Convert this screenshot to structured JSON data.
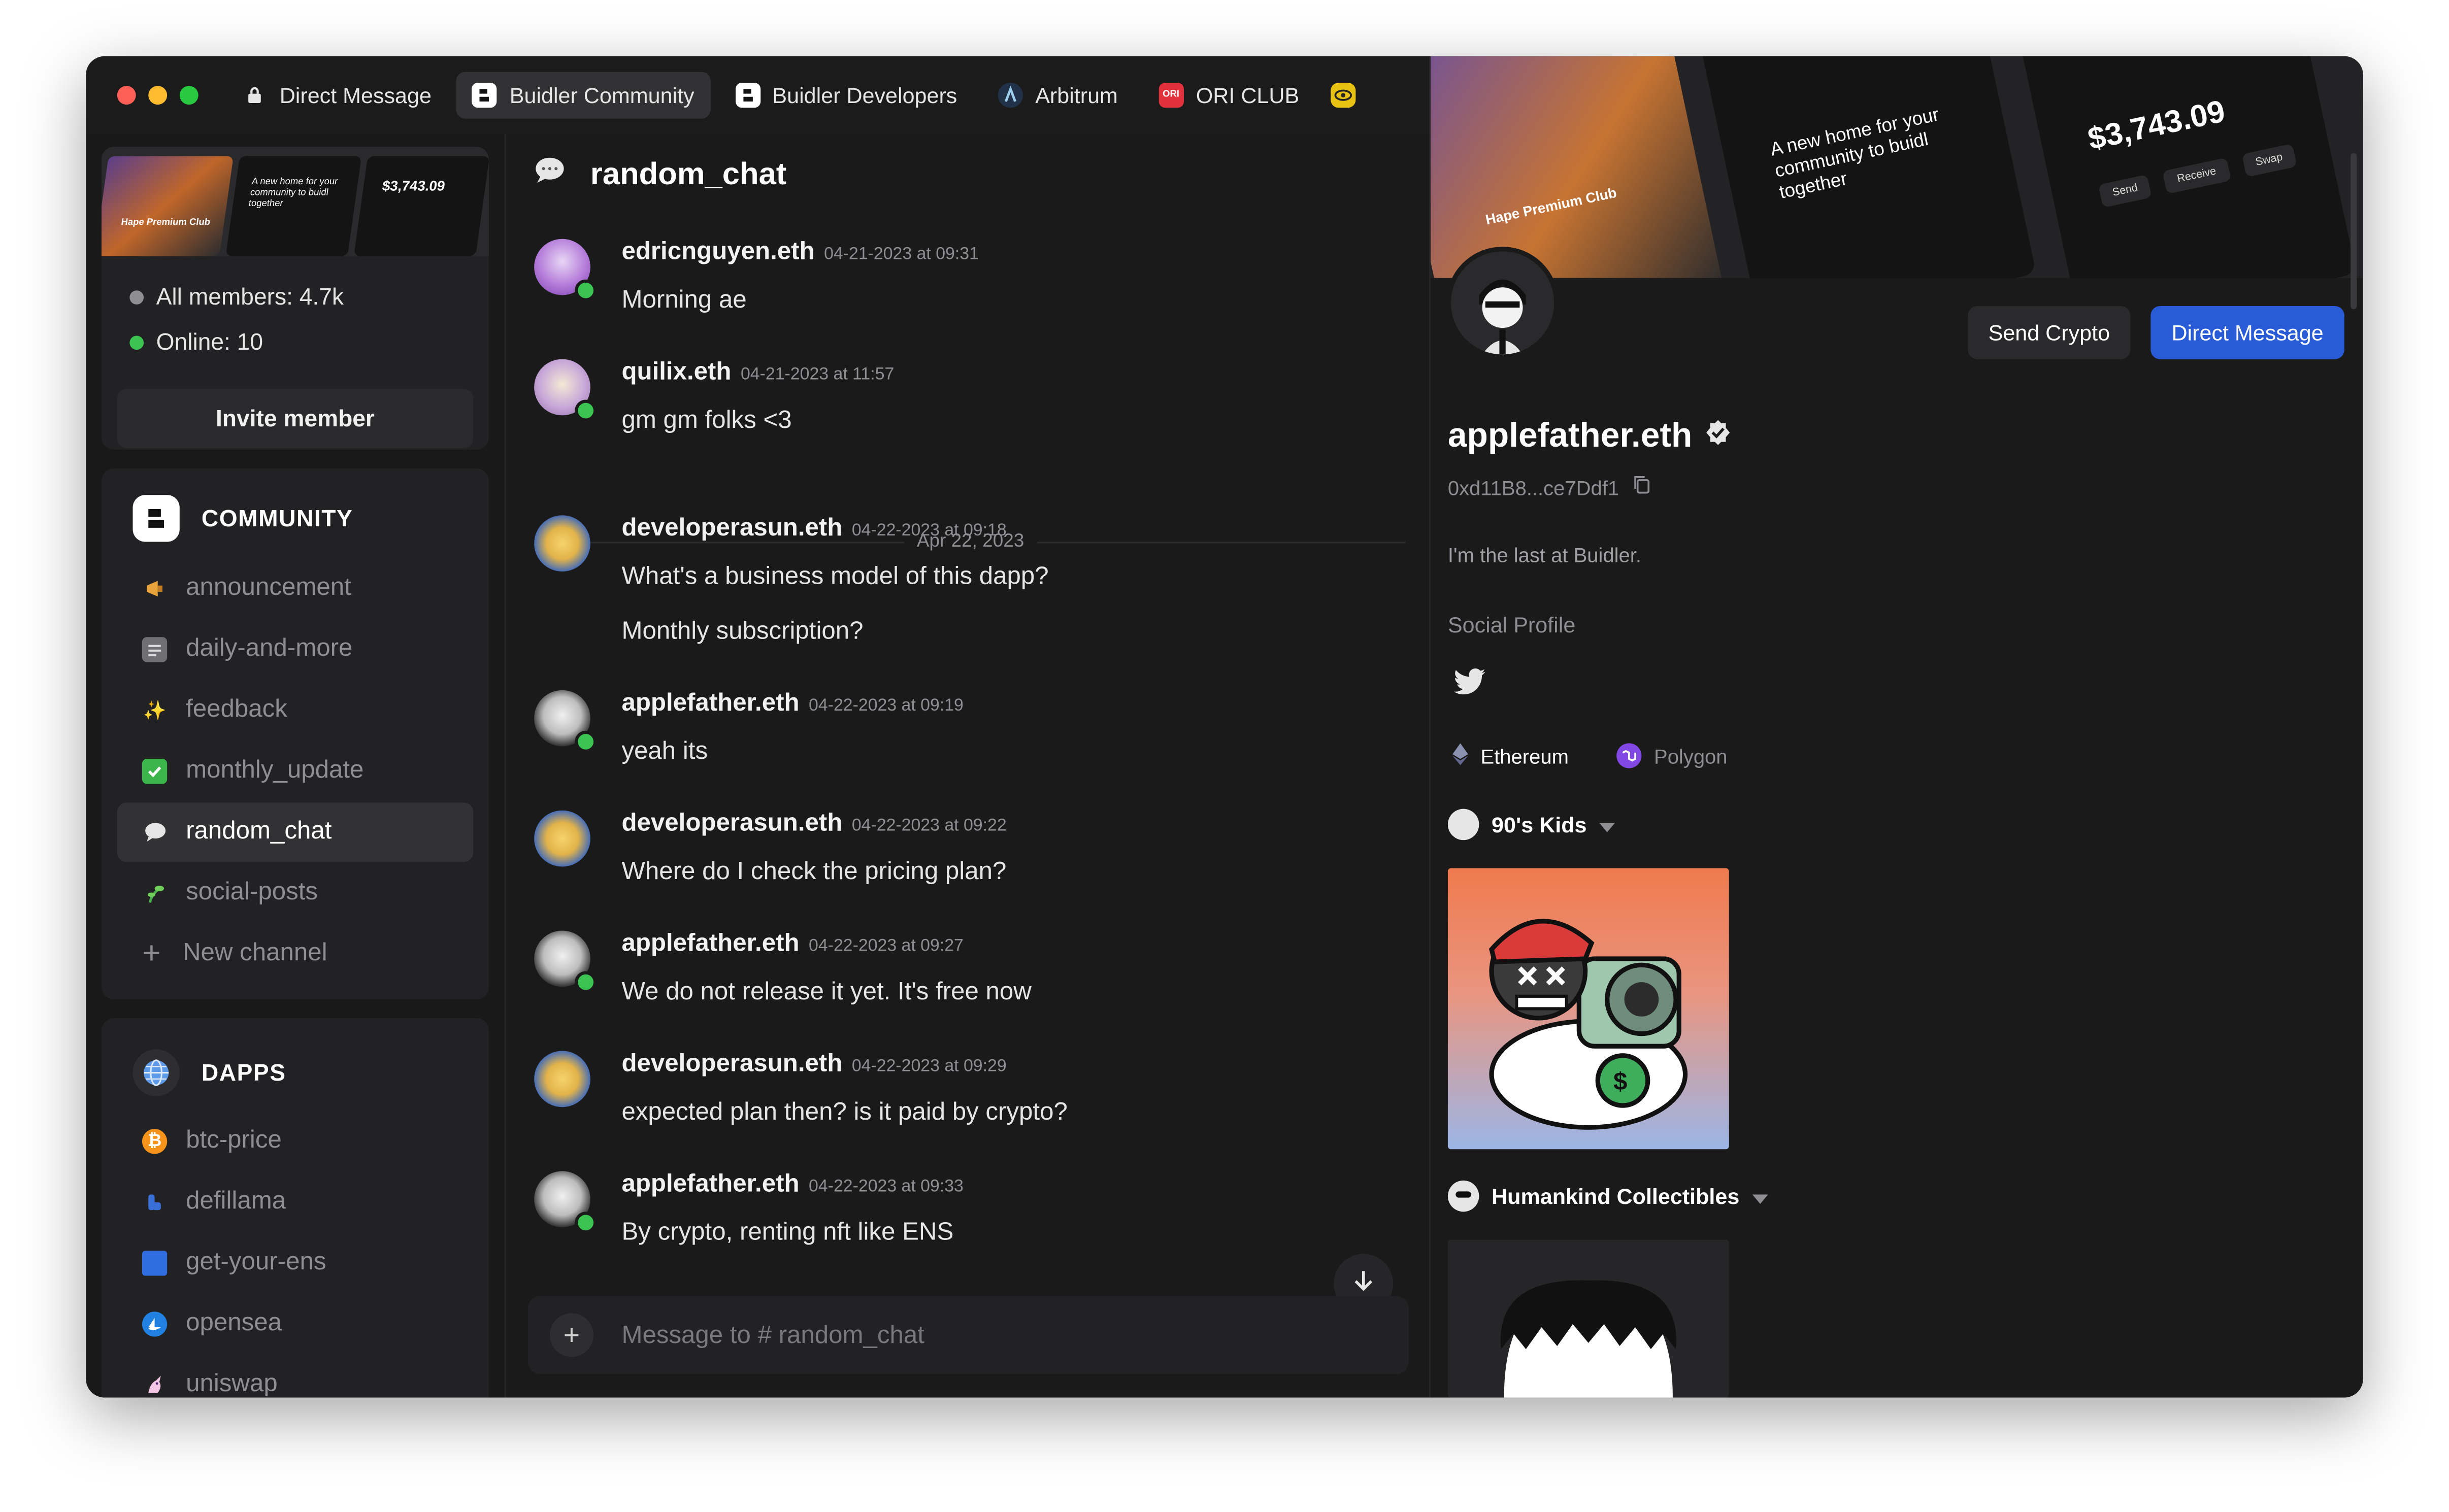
{
  "tabs": [
    {
      "label": "Direct Message",
      "icon": "lock-icon"
    },
    {
      "label": "Buidler Community",
      "icon": "buidler-logo-icon",
      "active": true
    },
    {
      "label": "Buidler Developers",
      "icon": "buidler-logo-icon"
    },
    {
      "label": "Arbitrum",
      "icon": "arbitrum-logo-icon"
    },
    {
      "label": "ORI CLUB",
      "icon": "ori-club-logo-icon"
    }
  ],
  "sidebar": {
    "banner_price": "$3,743.09",
    "banner_text": "A new home for your community to buidl together",
    "banner_club": "Hape Premium Club",
    "all_members": "All members: 4.7k",
    "online": "Online: 10",
    "invite_label": "Invite member",
    "community": {
      "title": "COMMUNITY",
      "channels": [
        {
          "name": "announcement",
          "icon": "megaphone-icon"
        },
        {
          "name": "daily-and-more",
          "icon": "newspaper-icon"
        },
        {
          "name": "feedback",
          "icon": "sparkles-icon"
        },
        {
          "name": "monthly_update",
          "icon": "check-box-icon"
        },
        {
          "name": "random_chat",
          "icon": "speech-bubble-icon",
          "active": true
        },
        {
          "name": "social-posts",
          "icon": "seedling-icon"
        }
      ],
      "new_channel": "New channel"
    },
    "dapps": {
      "title": "DAPPS",
      "items": [
        {
          "name": "btc-price",
          "icon": "bitcoin-icon"
        },
        {
          "name": "defillama",
          "icon": "llama-icon"
        },
        {
          "name": "get-your-ens",
          "icon": "blue-square-icon"
        },
        {
          "name": "opensea",
          "icon": "opensea-icon"
        },
        {
          "name": "uniswap",
          "icon": "unicorn-icon"
        }
      ]
    }
  },
  "chat": {
    "channel": "random_chat",
    "date_divider": "Apr 22, 2023",
    "messages": [
      {
        "user": "edricnguyen.eth",
        "time": "04-21-2023 at 09:31",
        "lines": [
          "Morning ae"
        ]
      },
      {
        "user": "quilix.eth",
        "time": "04-21-2023 at 11:57",
        "lines": [
          "gm gm folks <3"
        ]
      },
      {
        "user": "developerasun.eth",
        "time": "04-22-2023 at 09:18",
        "lines": [
          "What's a business model of this dapp?",
          "Monthly subscription?"
        ]
      },
      {
        "user": "applefather.eth",
        "time": "04-22-2023 at 09:19",
        "lines": [
          "yeah its"
        ]
      },
      {
        "user": "developerasun.eth",
        "time": "04-22-2023 at 09:22",
        "lines": [
          "Where do I check the pricing plan?"
        ]
      },
      {
        "user": "applefather.eth",
        "time": "04-22-2023 at 09:27",
        "lines": [
          "We do not release it yet. It's free now"
        ]
      },
      {
        "user": "developerasun.eth",
        "time": "04-22-2023 at 09:29",
        "lines": [
          "expected plan then? is it paid by crypto?"
        ]
      },
      {
        "user": "applefather.eth",
        "time": "04-22-2023 at 09:33",
        "lines": [
          "By crypto, renting nft like ENS"
        ]
      }
    ],
    "composer_placeholder": "Message to # random_chat"
  },
  "profile": {
    "cover_price": "$3,743.09",
    "cover_text": "A new home for your community to buidl together",
    "cover_club": "Hape Premium Club",
    "cover_actions": [
      "Send",
      "Receive",
      "Swap"
    ],
    "send_crypto": "Send Crypto",
    "direct_message": "Direct Message",
    "name": "applefather.eth",
    "address": "0xd11B8...ce7Ddf1",
    "bio": "I'm the last at Buidler.",
    "social_label": "Social Profile",
    "chains": [
      {
        "name": "Ethereum",
        "active": true
      },
      {
        "name": "Polygon",
        "active": false
      }
    ],
    "collections": [
      {
        "name": "90's Kids"
      },
      {
        "name": "Humankind Collectibles"
      }
    ]
  },
  "colors": {
    "accent": "#2a5bd7",
    "online": "#3bc452",
    "background": "#1a1a1b"
  }
}
